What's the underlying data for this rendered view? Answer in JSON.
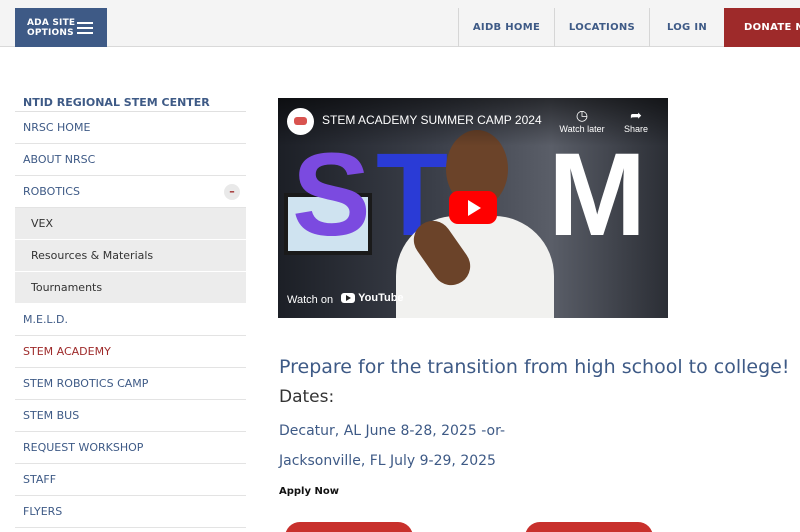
{
  "topbar": {
    "ada_label_line1": "ADA SITE",
    "ada_label_line2": "OPTIONS",
    "nav": [
      {
        "label": "AIDB HOME"
      },
      {
        "label": "LOCATIONS"
      },
      {
        "label": "LOG IN"
      },
      {
        "label": "DONATE NO"
      }
    ]
  },
  "sidebar": {
    "title": "NTID REGIONAL STEM CENTER",
    "items": [
      {
        "label": "NRSC HOME"
      },
      {
        "label": "ABOUT NRSC"
      },
      {
        "label": "ROBOTICS",
        "toggle": "–"
      },
      {
        "label": "VEX"
      },
      {
        "label": "Resources & Materials"
      },
      {
        "label": "Tournaments"
      },
      {
        "label": "M.E.L.D."
      },
      {
        "label": "STEM ACADEMY"
      },
      {
        "label": "STEM ROBOTICS CAMP"
      },
      {
        "label": "STEM BUS"
      },
      {
        "label": "REQUEST WORKSHOP"
      },
      {
        "label": "STAFF"
      },
      {
        "label": "FLYERS"
      }
    ]
  },
  "video": {
    "title": "STEM ACADEMY SUMMER CAMP 2024",
    "watch_later": "Watch later",
    "share": "Share",
    "watch_on": "Watch on",
    "youtube": "YouTube",
    "letters": [
      "S",
      "T",
      "M"
    ]
  },
  "main": {
    "heading": "Prepare for the transition from high school to college!",
    "dates_label": "Dates:",
    "date1": "Decatur, AL June 8-28, 2025 -or-",
    "date2": "Jacksonville, FL July 9-29, 2025",
    "apply": "Apply Now"
  },
  "colors": {
    "brand_blue": "#3e5a86",
    "accent_red": "#9e2a2a",
    "button_red": "#c8302c"
  }
}
